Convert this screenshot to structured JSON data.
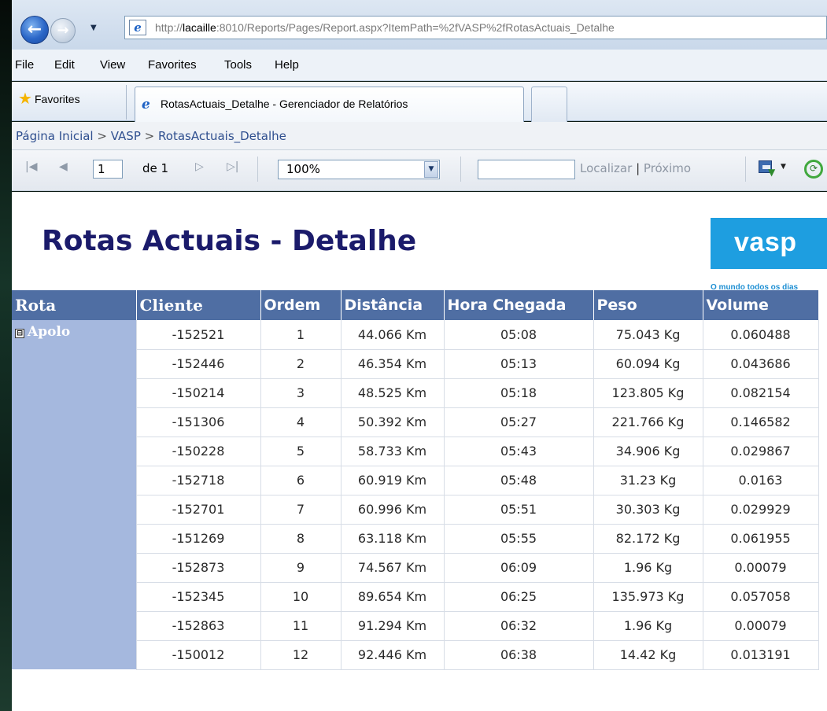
{
  "browser": {
    "address_prefix": "http://",
    "address_host": "lacaille",
    "address_rest": ":8010/Reports/Pages/Report.aspx?ItemPath=%2fVASP%2fRotasActuais_Detalhe",
    "menu": [
      "File",
      "Edit",
      "View",
      "Favorites",
      "Tools",
      "Help"
    ],
    "favorites_label": "Favorites",
    "tab_title": "RotasActuais_Detalhe - Gerenciador de Relatórios"
  },
  "viewer": {
    "breadcrumb": {
      "home": "Página Inicial",
      "sep": ">",
      "folder": "VASP",
      "report": "RotasActuais_Detalhe"
    },
    "toolbar": {
      "page_value": "1",
      "page_of": "de 1",
      "zoom": "100%",
      "find_value": "",
      "find_label": "Localizar",
      "find_sep": "|",
      "next_label": "Próximo"
    }
  },
  "report": {
    "title": "Rotas Actuais - Detalhe",
    "logo_text": "vasp",
    "logo_tagline": "O mundo todos os dias",
    "columns": [
      "Rota",
      "Cliente",
      "Ordem",
      "Distância",
      "Hora Chegada",
      "Peso",
      "Volume"
    ],
    "group": {
      "toggle": "⊟",
      "name": "Apolo"
    },
    "rows": [
      [
        "-152521",
        "1",
        "44.066 Km",
        "05:08",
        "75.043 Kg",
        "0.060488"
      ],
      [
        "-152446",
        "2",
        "46.354 Km",
        "05:13",
        "60.094 Kg",
        "0.043686"
      ],
      [
        "-150214",
        "3",
        "48.525 Km",
        "05:18",
        "123.805 Kg",
        "0.082154"
      ],
      [
        "-151306",
        "4",
        "50.392 Km",
        "05:27",
        "221.766 Kg",
        "0.146582"
      ],
      [
        "-150228",
        "5",
        "58.733 Km",
        "05:43",
        "34.906 Kg",
        "0.029867"
      ],
      [
        "-152718",
        "6",
        "60.919 Km",
        "05:48",
        "31.23 Kg",
        "0.0163"
      ],
      [
        "-152701",
        "7",
        "60.996 Km",
        "05:51",
        "30.303 Kg",
        "0.029929"
      ],
      [
        "-151269",
        "8",
        "63.118 Km",
        "05:55",
        "82.172 Kg",
        "0.061955"
      ],
      [
        "-152873",
        "9",
        "74.567 Km",
        "06:09",
        "1.96 Kg",
        "0.00079"
      ],
      [
        "-152345",
        "10",
        "89.654 Km",
        "06:25",
        "135.973 Kg",
        "0.057058"
      ],
      [
        "-152863",
        "11",
        "91.294 Km",
        "06:32",
        "1.96 Kg",
        "0.00079"
      ],
      [
        "-150012",
        "12",
        "92.446 Km",
        "06:38",
        "14.42 Kg",
        "0.013191"
      ]
    ]
  }
}
